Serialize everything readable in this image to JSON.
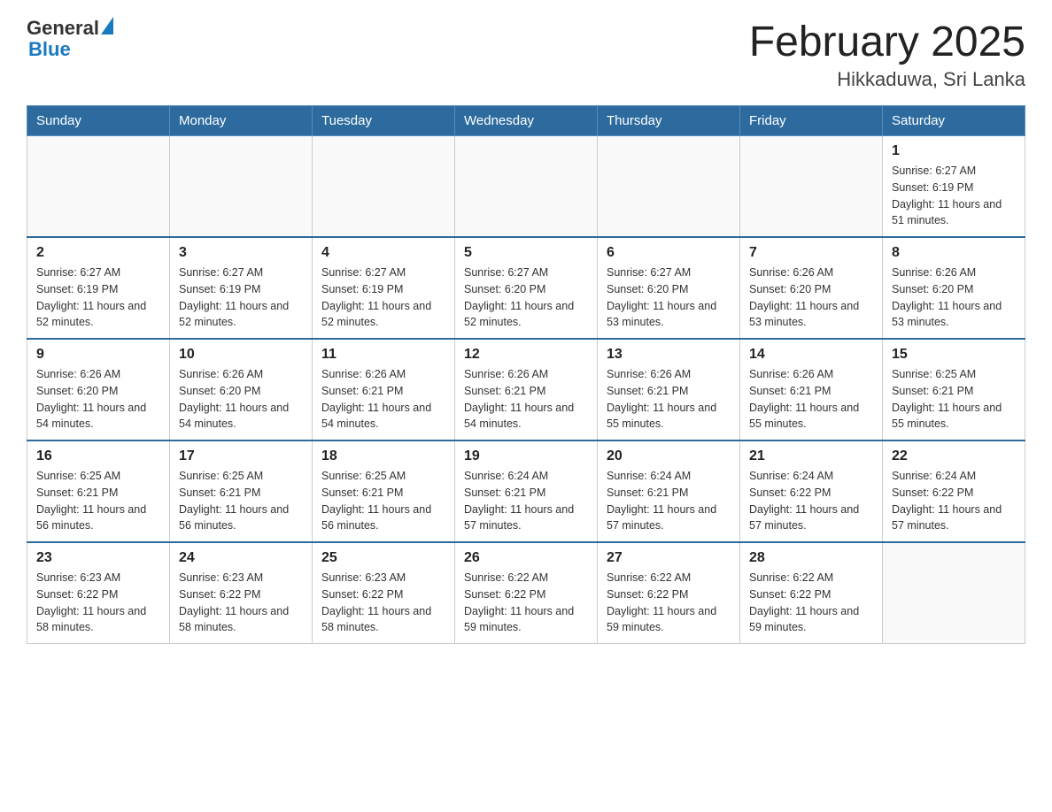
{
  "header": {
    "logo_general": "General",
    "logo_blue": "Blue",
    "title": "February 2025",
    "subtitle": "Hikkaduwa, Sri Lanka"
  },
  "days_of_week": [
    "Sunday",
    "Monday",
    "Tuesday",
    "Wednesday",
    "Thursday",
    "Friday",
    "Saturday"
  ],
  "weeks": [
    [
      {
        "day": "",
        "info": ""
      },
      {
        "day": "",
        "info": ""
      },
      {
        "day": "",
        "info": ""
      },
      {
        "day": "",
        "info": ""
      },
      {
        "day": "",
        "info": ""
      },
      {
        "day": "",
        "info": ""
      },
      {
        "day": "1",
        "info": "Sunrise: 6:27 AM\nSunset: 6:19 PM\nDaylight: 11 hours and 51 minutes."
      }
    ],
    [
      {
        "day": "2",
        "info": "Sunrise: 6:27 AM\nSunset: 6:19 PM\nDaylight: 11 hours and 52 minutes."
      },
      {
        "day": "3",
        "info": "Sunrise: 6:27 AM\nSunset: 6:19 PM\nDaylight: 11 hours and 52 minutes."
      },
      {
        "day": "4",
        "info": "Sunrise: 6:27 AM\nSunset: 6:19 PM\nDaylight: 11 hours and 52 minutes."
      },
      {
        "day": "5",
        "info": "Sunrise: 6:27 AM\nSunset: 6:20 PM\nDaylight: 11 hours and 52 minutes."
      },
      {
        "day": "6",
        "info": "Sunrise: 6:27 AM\nSunset: 6:20 PM\nDaylight: 11 hours and 53 minutes."
      },
      {
        "day": "7",
        "info": "Sunrise: 6:26 AM\nSunset: 6:20 PM\nDaylight: 11 hours and 53 minutes."
      },
      {
        "day": "8",
        "info": "Sunrise: 6:26 AM\nSunset: 6:20 PM\nDaylight: 11 hours and 53 minutes."
      }
    ],
    [
      {
        "day": "9",
        "info": "Sunrise: 6:26 AM\nSunset: 6:20 PM\nDaylight: 11 hours and 54 minutes."
      },
      {
        "day": "10",
        "info": "Sunrise: 6:26 AM\nSunset: 6:20 PM\nDaylight: 11 hours and 54 minutes."
      },
      {
        "day": "11",
        "info": "Sunrise: 6:26 AM\nSunset: 6:21 PM\nDaylight: 11 hours and 54 minutes."
      },
      {
        "day": "12",
        "info": "Sunrise: 6:26 AM\nSunset: 6:21 PM\nDaylight: 11 hours and 54 minutes."
      },
      {
        "day": "13",
        "info": "Sunrise: 6:26 AM\nSunset: 6:21 PM\nDaylight: 11 hours and 55 minutes."
      },
      {
        "day": "14",
        "info": "Sunrise: 6:26 AM\nSunset: 6:21 PM\nDaylight: 11 hours and 55 minutes."
      },
      {
        "day": "15",
        "info": "Sunrise: 6:25 AM\nSunset: 6:21 PM\nDaylight: 11 hours and 55 minutes."
      }
    ],
    [
      {
        "day": "16",
        "info": "Sunrise: 6:25 AM\nSunset: 6:21 PM\nDaylight: 11 hours and 56 minutes."
      },
      {
        "day": "17",
        "info": "Sunrise: 6:25 AM\nSunset: 6:21 PM\nDaylight: 11 hours and 56 minutes."
      },
      {
        "day": "18",
        "info": "Sunrise: 6:25 AM\nSunset: 6:21 PM\nDaylight: 11 hours and 56 minutes."
      },
      {
        "day": "19",
        "info": "Sunrise: 6:24 AM\nSunset: 6:21 PM\nDaylight: 11 hours and 57 minutes."
      },
      {
        "day": "20",
        "info": "Sunrise: 6:24 AM\nSunset: 6:21 PM\nDaylight: 11 hours and 57 minutes."
      },
      {
        "day": "21",
        "info": "Sunrise: 6:24 AM\nSunset: 6:22 PM\nDaylight: 11 hours and 57 minutes."
      },
      {
        "day": "22",
        "info": "Sunrise: 6:24 AM\nSunset: 6:22 PM\nDaylight: 11 hours and 57 minutes."
      }
    ],
    [
      {
        "day": "23",
        "info": "Sunrise: 6:23 AM\nSunset: 6:22 PM\nDaylight: 11 hours and 58 minutes."
      },
      {
        "day": "24",
        "info": "Sunrise: 6:23 AM\nSunset: 6:22 PM\nDaylight: 11 hours and 58 minutes."
      },
      {
        "day": "25",
        "info": "Sunrise: 6:23 AM\nSunset: 6:22 PM\nDaylight: 11 hours and 58 minutes."
      },
      {
        "day": "26",
        "info": "Sunrise: 6:22 AM\nSunset: 6:22 PM\nDaylight: 11 hours and 59 minutes."
      },
      {
        "day": "27",
        "info": "Sunrise: 6:22 AM\nSunset: 6:22 PM\nDaylight: 11 hours and 59 minutes."
      },
      {
        "day": "28",
        "info": "Sunrise: 6:22 AM\nSunset: 6:22 PM\nDaylight: 11 hours and 59 minutes."
      },
      {
        "day": "",
        "info": ""
      }
    ]
  ]
}
